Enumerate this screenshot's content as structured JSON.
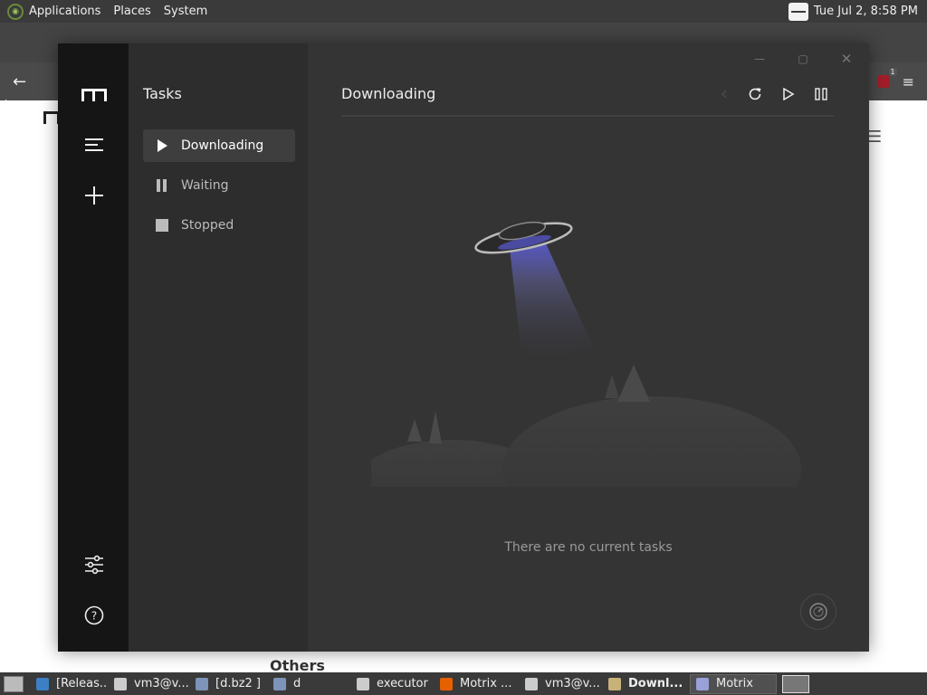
{
  "top_panel": {
    "menus": [
      "Applications",
      "Places",
      "System"
    ],
    "clock": "Tue Jul 2, 8:58 PM"
  },
  "background_browser": {
    "ublock_badge": "1",
    "page_heading_partial": "Others"
  },
  "motrix": {
    "sidebar_title": "Tasks",
    "task_filters": [
      {
        "label": "Downloading",
        "icon": "play-icon",
        "active": true
      },
      {
        "label": "Waiting",
        "icon": "pause-icon",
        "active": false
      },
      {
        "label": "Stopped",
        "icon": "stop-icon",
        "active": false
      }
    ],
    "main_title": "Downloading",
    "empty_message": "There are no current tasks"
  },
  "taskbar": {
    "items": [
      {
        "label": "[Releas...",
        "icon": "vscode-icon",
        "color": "#3c7fc4"
      },
      {
        "label": "vm3@v...",
        "icon": "terminal-icon",
        "color": "#cccccc"
      },
      {
        "label": "[d.bz2 ]",
        "icon": "archive-icon",
        "color": "#7d93b8"
      },
      {
        "label": "d",
        "icon": "network-icon",
        "color": "#7d93b8"
      },
      {
        "label": "executor",
        "icon": "window-icon",
        "color": "#cccccc"
      },
      {
        "label": "Motrix ...",
        "icon": "firefox-icon",
        "color": "#e66000"
      },
      {
        "label": "vm3@v...",
        "icon": "terminal-icon",
        "color": "#cccccc"
      },
      {
        "label": "Downl...",
        "icon": "folder-icon",
        "color": "#c9b27a",
        "bold": true
      },
      {
        "label": "Motrix",
        "icon": "motrix-icon",
        "color": "#9aa0d8",
        "active": true
      }
    ]
  },
  "colors": {
    "motrix_aside": "#151515",
    "motrix_sub": "#2d2d2d",
    "motrix_main": "#343434",
    "ufo_beam": "#5a5ad6"
  }
}
